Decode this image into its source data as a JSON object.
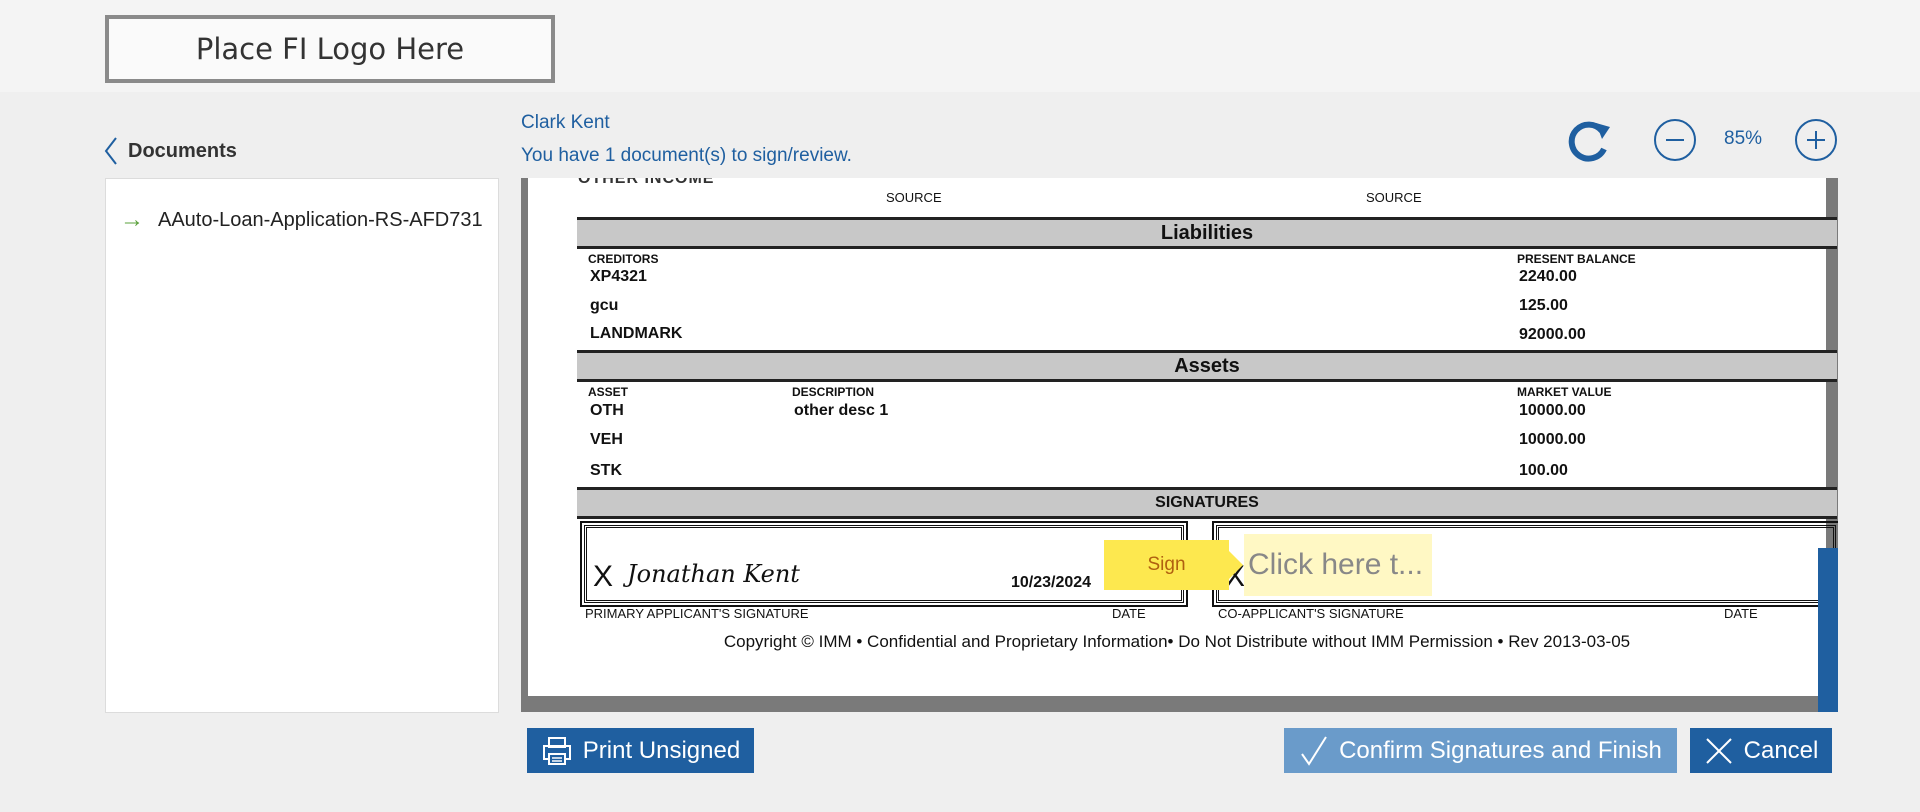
{
  "header": {
    "logo_text": "Place FI Logo Here"
  },
  "sidebar": {
    "title": "Documents",
    "items": [
      {
        "label": "AAuto-Loan-Application-RS-AFD731"
      }
    ]
  },
  "user": {
    "name": "Clark Kent",
    "message": "You have 1 document(s) to sign/review."
  },
  "zoom": {
    "level": "85%"
  },
  "document": {
    "cut_text": "OTHER INCOME",
    "source_left": "SOURCE",
    "source_right": "SOURCE",
    "liabilities": {
      "title": "Liabilities",
      "col_creditors": "CREDITORS",
      "col_balance": "PRESENT BALANCE",
      "rows": [
        {
          "creditor": "XP4321",
          "balance": "2240.00"
        },
        {
          "creditor": "gcu",
          "balance": "125.00"
        },
        {
          "creditor": "LANDMARK",
          "balance": "92000.00"
        }
      ]
    },
    "assets": {
      "title": "Assets",
      "col_asset": "ASSET",
      "col_description": "DESCRIPTION",
      "col_value": "MARKET VALUE",
      "rows": [
        {
          "asset": "OTH",
          "description": "other desc 1",
          "value": "10000.00"
        },
        {
          "asset": "VEH",
          "description": "",
          "value": "10000.00"
        },
        {
          "asset": "STK",
          "description": "",
          "value": "100.00"
        }
      ]
    },
    "signatures": {
      "title": "SIGNATURES",
      "x_mark": "X",
      "primary_signature": "Jonathan Kent",
      "primary_date": "10/23/2024",
      "primary_label": "PRIMARY APPLICANT'S SIGNATURE",
      "date_label": "DATE",
      "coapplicant_label": "CO-APPLICANT'S SIGNATURE",
      "sign_tag": "Sign",
      "click_field": "Click here t..."
    },
    "copyright": "Copyright © IMM • Confidential and Proprietary Information• Do Not Distribute without IMM Permission • Rev 2013-03-05"
  },
  "buttons": {
    "print": "Print Unsigned",
    "confirm": "Confirm Signatures and Finish",
    "cancel": "Cancel"
  },
  "colors": {
    "primary": "#1f5fa0",
    "confirm_disabled": "#6a9bca",
    "sign_tag": "#fde84f",
    "click_field": "#fff8c4"
  },
  "icons": [
    "chevron-left-icon",
    "arrow-right-icon",
    "refresh-icon",
    "zoom-out-icon",
    "zoom-in-icon",
    "printer-icon",
    "check-icon",
    "close-icon"
  ]
}
